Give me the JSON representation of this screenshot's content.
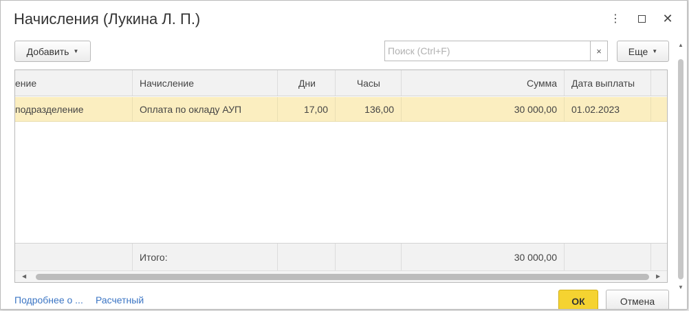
{
  "window": {
    "title": "Начисления (Лукина Л. П.)"
  },
  "toolbar": {
    "add_label": "Добавить",
    "search_placeholder": "Поиск (Ctrl+F)",
    "clear_label": "×",
    "more_label": "Еще"
  },
  "table": {
    "columns": [
      "ение",
      "Начисление",
      "Дни",
      "Часы",
      "Сумма",
      "Дата выплаты"
    ],
    "rows": [
      {
        "dept": "подразделение",
        "accrual": "Оплата по окладу АУП",
        "days": "17,00",
        "hours": "136,00",
        "sum": "30 000,00",
        "date": "01.02.2023"
      }
    ],
    "footer": {
      "label": "Итого:",
      "sum": "30 000,00"
    }
  },
  "bottom": {
    "link1": "Подробнее о ...",
    "link2": "Расчетный",
    "ok_label": "ОК",
    "cancel_label": "Отмена"
  }
}
